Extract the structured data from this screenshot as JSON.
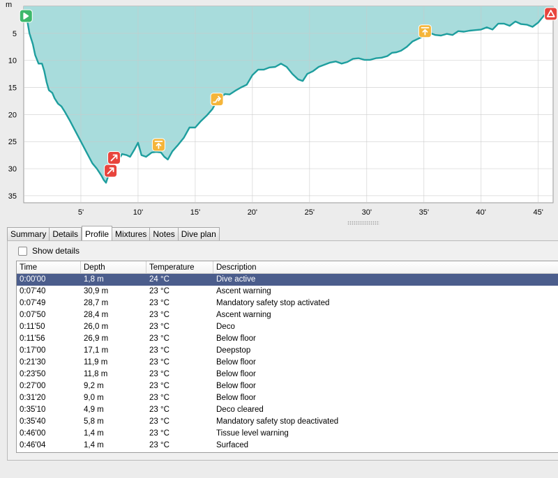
{
  "chart_data": {
    "type": "area",
    "unit_label": "m",
    "y_ticks": [
      "5",
      "10",
      "15",
      "20",
      "25",
      "30",
      "35"
    ],
    "x_ticks": [
      "5'",
      "10'",
      "15'",
      "20'",
      "25'",
      "30'",
      "35'",
      "40'",
      "45'"
    ],
    "xlim": [
      0,
      46.3
    ],
    "ylim": [
      0,
      36.3
    ],
    "fill_color": "#a8dcdc",
    "line_color": "#1e9e9e",
    "points": [
      [
        0,
        1.8
      ],
      [
        0.3,
        2.5
      ],
      [
        0.5,
        5
      ],
      [
        0.8,
        7
      ],
      [
        1,
        9
      ],
      [
        1.3,
        10.6
      ],
      [
        1.6,
        10.6
      ],
      [
        1.8,
        12
      ],
      [
        2,
        14
      ],
      [
        2.2,
        15.5
      ],
      [
        2.5,
        16
      ],
      [
        2.7,
        17
      ],
      [
        3,
        18
      ],
      [
        3.3,
        18.5
      ],
      [
        3.6,
        19.5
      ],
      [
        4,
        21
      ],
      [
        4.5,
        23
      ],
      [
        5,
        25
      ],
      [
        5.5,
        27
      ],
      [
        6,
        29
      ],
      [
        6.4,
        30
      ],
      [
        6.8,
        31.3
      ],
      [
        7,
        32.1
      ],
      [
        7.2,
        32.6
      ],
      [
        7.4,
        31.3
      ],
      [
        7.6,
        30.9
      ],
      [
        7.8,
        29.3
      ],
      [
        8,
        28.7
      ],
      [
        8.3,
        28.3
      ],
      [
        8.6,
        27.3
      ],
      [
        9,
        27.5
      ],
      [
        9.3,
        27.8
      ],
      [
        9.7,
        26.4
      ],
      [
        10,
        25.2
      ],
      [
        10.3,
        27.5
      ],
      [
        10.7,
        27.8
      ],
      [
        11.2,
        27
      ],
      [
        11.6,
        26.9
      ],
      [
        12,
        27
      ],
      [
        12.3,
        27.8
      ],
      [
        12.6,
        28.3
      ],
      [
        13,
        26.8
      ],
      [
        13.5,
        25.6
      ],
      [
        14,
        24.3
      ],
      [
        14.5,
        22.4
      ],
      [
        15,
        22.4
      ],
      [
        15.5,
        21.2
      ],
      [
        16,
        20.2
      ],
      [
        16.5,
        19
      ],
      [
        17,
        17.1
      ],
      [
        17.3,
        16.8
      ],
      [
        17.6,
        16.2
      ],
      [
        18,
        16.3
      ],
      [
        18.5,
        15.6
      ],
      [
        19,
        15
      ],
      [
        19.5,
        14.5
      ],
      [
        20,
        12.7
      ],
      [
        20.5,
        11.7
      ],
      [
        21,
        11.7
      ],
      [
        21.5,
        11.3
      ],
      [
        22,
        11.2
      ],
      [
        22.5,
        10.6
      ],
      [
        23,
        11.2
      ],
      [
        23.5,
        12.5
      ],
      [
        24,
        13.5
      ],
      [
        24.4,
        13.8
      ],
      [
        24.8,
        12.5
      ],
      [
        25.3,
        12
      ],
      [
        25.8,
        11.2
      ],
      [
        26.3,
        10.8
      ],
      [
        26.8,
        10.4
      ],
      [
        27.3,
        10.2
      ],
      [
        27.8,
        10.6
      ],
      [
        28.3,
        10.3
      ],
      [
        28.8,
        9.7
      ],
      [
        29.3,
        9.6
      ],
      [
        29.8,
        9.9
      ],
      [
        30.3,
        9.9
      ],
      [
        30.8,
        9.6
      ],
      [
        31.3,
        9.5
      ],
      [
        31.8,
        9.2
      ],
      [
        32.2,
        8.6
      ],
      [
        32.6,
        8.5
      ],
      [
        33,
        8.2
      ],
      [
        33.5,
        7.5
      ],
      [
        34,
        6.5
      ],
      [
        34.5,
        6
      ],
      [
        35,
        5.5
      ],
      [
        35.5,
        4.9
      ],
      [
        36,
        5.3
      ],
      [
        36.5,
        5.4
      ],
      [
        37,
        5.1
      ],
      [
        37.5,
        5.3
      ],
      [
        38,
        4.6
      ],
      [
        38.5,
        4.7
      ],
      [
        39,
        4.5
      ],
      [
        39.5,
        4.4
      ],
      [
        40,
        4.3
      ],
      [
        40.5,
        3.9
      ],
      [
        41,
        4.3
      ],
      [
        41.5,
        3.2
      ],
      [
        42,
        3.2
      ],
      [
        42.5,
        3.6
      ],
      [
        43,
        2.8
      ],
      [
        43.5,
        3.3
      ],
      [
        44,
        3.4
      ],
      [
        44.5,
        3.8
      ],
      [
        45,
        3
      ],
      [
        45.5,
        1.7
      ],
      [
        46,
        1.4
      ],
      [
        46.3,
        1.4
      ]
    ]
  },
  "markers": [
    {
      "icon": "dive-start-icon",
      "t": 0.2,
      "d": 1.8,
      "color": "#3db86b"
    },
    {
      "icon": "ascent-warning-icon",
      "t": 7.9,
      "d": 28.0,
      "color": "#e8443c"
    },
    {
      "icon": "ascent-warning-icon",
      "t": 7.6,
      "d": 30.4,
      "color": "#e8443c"
    },
    {
      "icon": "deco-stop-icon",
      "t": 11.8,
      "d": 25.6,
      "color": "#f5b53a"
    },
    {
      "icon": "deepstop-icon",
      "t": 16.9,
      "d": 17.2,
      "color": "#f5b53a"
    },
    {
      "icon": "deco-cleared-icon",
      "t": 35.1,
      "d": 4.6,
      "color": "#f5b53a"
    },
    {
      "icon": "surfaced-warning-icon",
      "t": 46.1,
      "d": 1.4,
      "color": "#e8443c"
    }
  ],
  "tabs": [
    {
      "label": "Summary",
      "active": false
    },
    {
      "label": "Details",
      "active": false
    },
    {
      "label": "Profile",
      "active": true
    },
    {
      "label": "Mixtures",
      "active": false
    },
    {
      "label": "Notes",
      "active": false
    },
    {
      "label": "Dive plan",
      "active": false
    }
  ],
  "show_details_label": "Show details",
  "table": {
    "columns": [
      "Time",
      "Depth",
      "Temperature",
      "Description"
    ],
    "rows": [
      [
        "0:00'00",
        "1,8 m",
        "24 °C",
        "Dive active"
      ],
      [
        "0:07'40",
        "30,9 m",
        "23 °C",
        "Ascent warning"
      ],
      [
        "0:07'49",
        "28,7 m",
        "23 °C",
        "Mandatory safety stop activated"
      ],
      [
        "0:07'50",
        "28,4 m",
        "23 °C",
        "Ascent warning"
      ],
      [
        "0:11'50",
        "26,0 m",
        "23 °C",
        "Deco"
      ],
      [
        "0:11'56",
        "26,9 m",
        "23 °C",
        "Below floor"
      ],
      [
        "0:17'00",
        "17,1 m",
        "23 °C",
        "Deepstop"
      ],
      [
        "0:21'30",
        "11,9 m",
        "23 °C",
        "Below floor"
      ],
      [
        "0:23'50",
        "11,8 m",
        "23 °C",
        "Below floor"
      ],
      [
        "0:27'00",
        "9,2 m",
        "23 °C",
        "Below floor"
      ],
      [
        "0:31'20",
        "9,0 m",
        "23 °C",
        "Below floor"
      ],
      [
        "0:35'10",
        "4,9 m",
        "23 °C",
        "Deco cleared"
      ],
      [
        "0:35'40",
        "5,8 m",
        "23 °C",
        "Mandatory safety stop deactivated"
      ],
      [
        "0:46'00",
        "1,4 m",
        "23 °C",
        "Tissue level warning"
      ],
      [
        "0:46'04",
        "1,4 m",
        "23 °C",
        "Surfaced"
      ]
    ],
    "selected_row": 0
  }
}
